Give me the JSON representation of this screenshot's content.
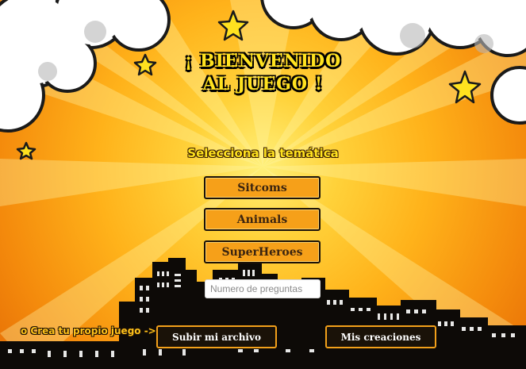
{
  "title": {
    "line1": "¡ BIENVENIDO",
    "line2": "AL JUEGO !"
  },
  "subtitle": "Selecciona la temática",
  "themes": [
    {
      "label": "Sitcoms"
    },
    {
      "label": "Animals"
    },
    {
      "label": "SuperHeroes"
    }
  ],
  "questions_input": {
    "placeholder": "Numero de preguntas",
    "value": ""
  },
  "create_label": "o Crea tu propio juego ->",
  "upload_button": "Subir mi archivo",
  "creations_button": "Mis creaciones",
  "colors": {
    "title_yellow": "#ffe21f",
    "button_orange": "#f6a019",
    "button_dark": "#1a1208",
    "background_orange": "#ffb21a"
  },
  "decor": [
    "clouds",
    "stars",
    "city-skyline"
  ]
}
